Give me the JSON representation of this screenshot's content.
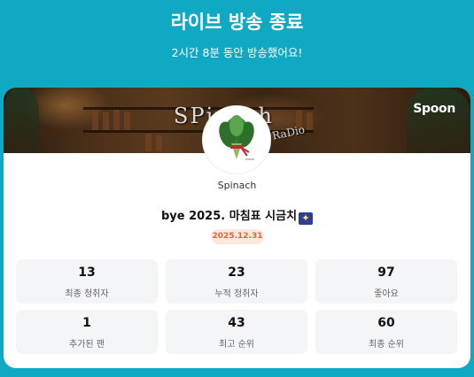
{
  "header": {
    "title": "라이브 방송 종료",
    "subtitle": "2시간 8분 동안 방송했어요!"
  },
  "card": {
    "banner_text": "SPinach",
    "banner_subtext": "RaDio",
    "brand": "Spoon",
    "host_name": "Spinach",
    "stream_title": "bye 2025. 마침표 시금치",
    "title_emoji": "✦",
    "date": "2025.12.31"
  },
  "stats": [
    {
      "value": "13",
      "label": "최종 청취자"
    },
    {
      "value": "23",
      "label": "누적 청취자"
    },
    {
      "value": "97",
      "label": "좋아요"
    },
    {
      "value": "1",
      "label": "추가된 팬"
    },
    {
      "value": "43",
      "label": "최고 순위"
    },
    {
      "value": "60",
      "label": "최종 순위"
    }
  ],
  "colors": {
    "background": "#10a9c3",
    "date_badge_bg": "#fde8e0",
    "date_badge_text": "#e8603a",
    "stat_bg": "#f4f5f7"
  },
  "icons": {
    "avatar": "spinach-bunch-icon"
  }
}
